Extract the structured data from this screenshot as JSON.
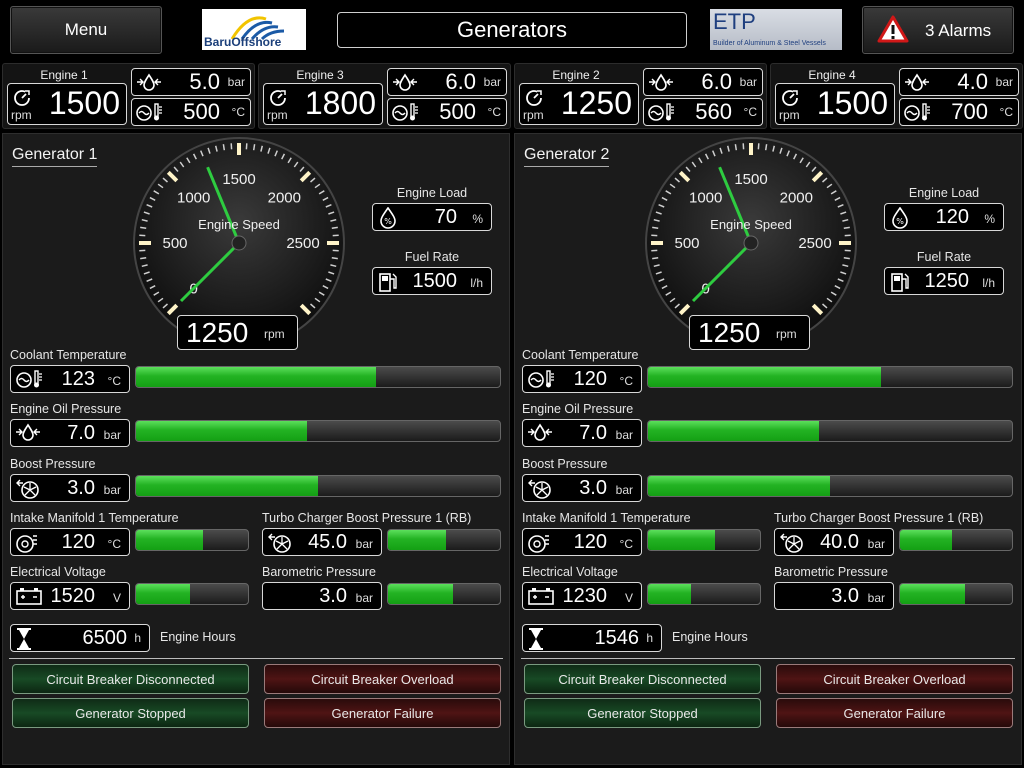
{
  "header": {
    "menu_label": "Menu",
    "title": "Generators",
    "alarms_label": "3 Alarms",
    "logo_left_text": "BaruOffshore",
    "logo_right_title": "ETP",
    "logo_right_sub": "Builder of Aluminum & Steel Vessels"
  },
  "engines": [
    {
      "name": "Engine 1",
      "rpm": "1500",
      "rpm_unit": "rpm",
      "pressure": "5.0",
      "pressure_unit": "bar",
      "temp": "500",
      "temp_unit": "°C"
    },
    {
      "name": "Engine 3",
      "rpm": "1800",
      "rpm_unit": "rpm",
      "pressure": "6.0",
      "pressure_unit": "bar",
      "temp": "500",
      "temp_unit": "°C"
    },
    {
      "name": "Engine 2",
      "rpm": "1250",
      "rpm_unit": "rpm",
      "pressure": "6.0",
      "pressure_unit": "bar",
      "temp": "560",
      "temp_unit": "°C"
    },
    {
      "name": "Engine 4",
      "rpm": "1500",
      "rpm_unit": "rpm",
      "pressure": "4.0",
      "pressure_unit": "bar",
      "temp": "700",
      "temp_unit": "°C"
    }
  ],
  "generators": [
    {
      "title": "Generator 1",
      "gauge": {
        "label": "Engine Speed",
        "value": "1250",
        "unit": "rpm",
        "ticks": [
          "0",
          "500",
          "1000",
          "1500",
          "2000",
          "2500"
        ],
        "needle_value": 1250,
        "max": 3000
      },
      "engine_load": {
        "label": "Engine Load",
        "value": "70",
        "unit": "%"
      },
      "fuel_rate": {
        "label": "Fuel Rate",
        "value": "1500",
        "unit": "l/h"
      },
      "coolant_temp": {
        "label": "Coolant Temperature",
        "value": "123",
        "unit": "°C",
        "level": 0.66
      },
      "oil_pressure": {
        "label": "Engine Oil Pressure",
        "value": "7.0",
        "unit": "bar",
        "level": 0.47
      },
      "boost_pressure": {
        "label": "Boost Pressure",
        "value": "3.0",
        "unit": "bar",
        "level": 0.5
      },
      "intake_temp": {
        "label": "Intake Manifold 1 Temperature",
        "value": "120",
        "unit": "°C",
        "level": 0.6
      },
      "turbo_boost": {
        "label": "Turbo Charger Boost Pressure 1 (RB)",
        "value": "45.0",
        "unit": "bar",
        "level": 0.52
      },
      "voltage": {
        "label": "Electrical Voltage",
        "value": "1520",
        "unit": "V",
        "level": 0.48
      },
      "baro_pressure": {
        "label": "Barometric Pressure",
        "value": "3.0",
        "unit": "bar",
        "level": 0.58
      },
      "engine_hours": {
        "label": "Engine Hours",
        "value": "6500",
        "unit": "h"
      },
      "status": {
        "cb_disconnected": "Circuit Breaker Disconnected",
        "cb_overload": "Circuit Breaker Overload",
        "gen_stopped": "Generator Stopped",
        "gen_failure": "Generator Failure"
      }
    },
    {
      "title": "Generator 2",
      "gauge": {
        "label": "Engine Speed",
        "value": "1250",
        "unit": "rpm",
        "ticks": [
          "0",
          "500",
          "1000",
          "1500",
          "2000",
          "2500"
        ],
        "needle_value": 1250,
        "max": 3000
      },
      "engine_load": {
        "label": "Engine Load",
        "value": "120",
        "unit": "%"
      },
      "fuel_rate": {
        "label": "Fuel Rate",
        "value": "1250",
        "unit": "l/h"
      },
      "coolant_temp": {
        "label": "Coolant Temperature",
        "value": "120",
        "unit": "°C",
        "level": 0.64
      },
      "oil_pressure": {
        "label": "Engine Oil Pressure",
        "value": "7.0",
        "unit": "bar",
        "level": 0.47
      },
      "boost_pressure": {
        "label": "Boost Pressure",
        "value": "3.0",
        "unit": "bar",
        "level": 0.5
      },
      "intake_temp": {
        "label": "Intake Manifold 1 Temperature",
        "value": "120",
        "unit": "°C",
        "level": 0.6
      },
      "turbo_boost": {
        "label": "Turbo Charger Boost Pressure 1 (RB)",
        "value": "40.0",
        "unit": "bar",
        "level": 0.46
      },
      "voltage": {
        "label": "Electrical Voltage",
        "value": "1230",
        "unit": "V",
        "level": 0.38
      },
      "baro_pressure": {
        "label": "Barometric Pressure",
        "value": "3.0",
        "unit": "bar",
        "level": 0.58
      },
      "engine_hours": {
        "label": "Engine Hours",
        "value": "1546",
        "unit": "h"
      },
      "status": {
        "cb_disconnected": "Circuit Breaker Disconnected",
        "cb_overload": "Circuit Breaker Overload",
        "gen_stopped": "Generator Stopped",
        "gen_failure": "Generator Failure"
      }
    }
  ],
  "colors": {
    "bar_green": "#23b323",
    "needle": "#2ecc40",
    "status_green": "#184a25",
    "status_red": "#4f1414",
    "alarm": "#d01818"
  }
}
